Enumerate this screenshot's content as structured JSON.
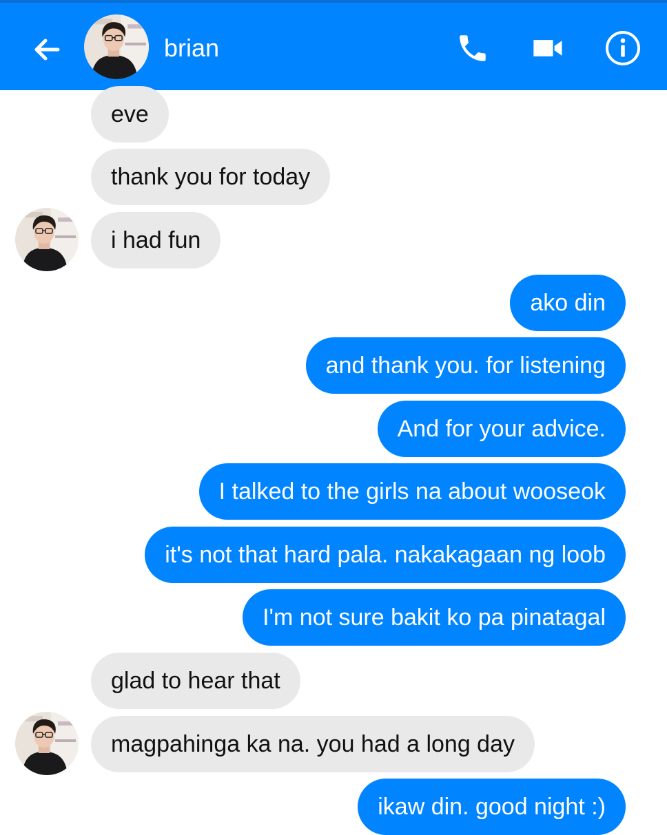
{
  "header": {
    "contact_name": "brian",
    "back_icon": "arrow-left-icon",
    "call_icon": "phone-icon",
    "video_icon": "video-camera-icon",
    "info_icon": "info-icon",
    "bar_color": "#0084ff"
  },
  "messages": [
    {
      "sender": "brian",
      "text": "eve"
    },
    {
      "sender": "brian",
      "text": "thank you for today"
    },
    {
      "sender": "brian",
      "text": "i had fun"
    },
    {
      "sender": "me",
      "text": "ako din"
    },
    {
      "sender": "me",
      "text": "and thank you. for listening"
    },
    {
      "sender": "me",
      "text": "And for your advice."
    },
    {
      "sender": "me",
      "text": "I talked to the girls na about wooseok"
    },
    {
      "sender": "me",
      "text": "it's not that hard pala. nakakagaan ng loob"
    },
    {
      "sender": "me",
      "text": "I'm not sure bakit ko pa pinatagal"
    },
    {
      "sender": "brian",
      "text": "glad to hear that"
    },
    {
      "sender": "brian",
      "text": "magpahinga ka na. you had a long day"
    },
    {
      "sender": "me",
      "text": "ikaw din. good night :)"
    }
  ],
  "colors": {
    "outgoing_bubble": "#0084ff",
    "incoming_bubble": "#e9e9e9"
  }
}
